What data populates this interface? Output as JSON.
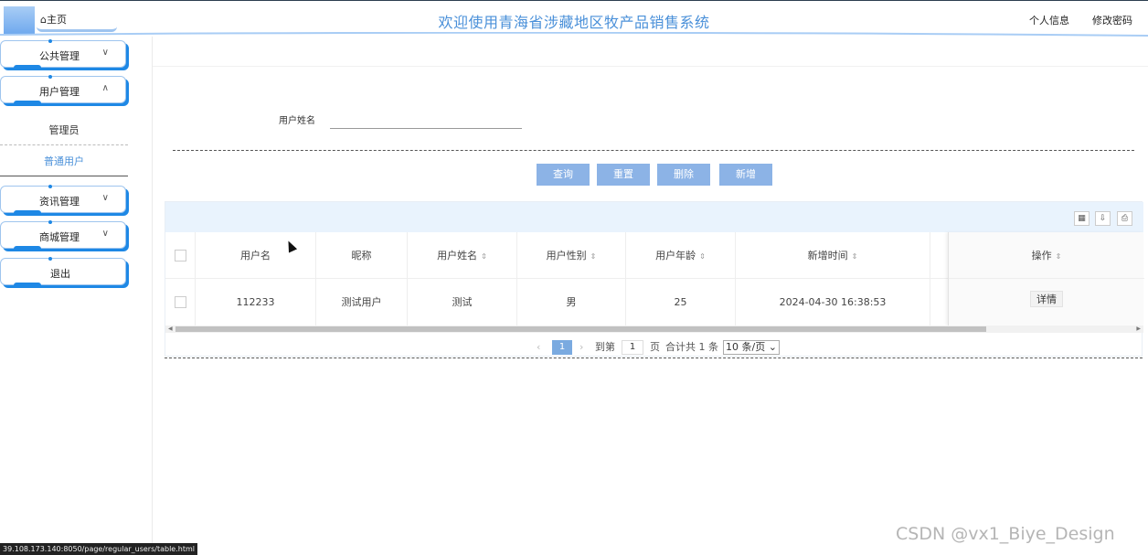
{
  "header": {
    "home_icon": "home-icon",
    "home_label": "⌂主页",
    "title": "欢迎使用青海省涉藏地区牧产品销售系统",
    "profile_link": "个人信息",
    "password_link": "修改密码"
  },
  "sidebar": {
    "menus": [
      {
        "label": "公共管理",
        "icon": "chevron-down-icon",
        "glyph": "∨"
      },
      {
        "label": "用户管理",
        "icon": "chevron-up-icon",
        "glyph": "∧"
      },
      {
        "label": "资讯管理",
        "icon": "chevron-down-icon",
        "glyph": "∨"
      },
      {
        "label": "商城管理",
        "icon": "chevron-down-icon",
        "glyph": "∨"
      },
      {
        "label": "退出"
      }
    ],
    "submenu": [
      {
        "label": "管理员"
      },
      {
        "label": "普通用户",
        "active": true
      }
    ]
  },
  "search": {
    "label": "用户姓名",
    "value": ""
  },
  "buttons": {
    "query": "查询",
    "reset": "重置",
    "delete": "删除",
    "add": "新增"
  },
  "table": {
    "columns": [
      "用户名",
      "昵称",
      "用户姓名",
      "用户性别",
      "用户年龄",
      "新增时间",
      "操作"
    ],
    "sortable": [
      false,
      false,
      true,
      true,
      true,
      true,
      true
    ],
    "rows": [
      {
        "username": "112233",
        "nickname": "测试用户",
        "name": "测试",
        "gender": "男",
        "age": "25",
        "created": "2024-04-30 16:38:53",
        "action": "详情"
      }
    ],
    "toolbar_icons": [
      "columns-icon",
      "export-icon",
      "print-icon"
    ]
  },
  "pagination": {
    "prev": "‹",
    "current": "1",
    "next": "›",
    "goto_label": "到第",
    "goto_value": "1",
    "page_unit": "页",
    "total_text": "合计共 1 条",
    "page_size": "10 条/页"
  },
  "status_url": "39.108.173.140:8050/page/regular_users/table.html",
  "watermark": "CSDN @vx1_Biye_Design",
  "colors": {
    "accent": "#1e88e5",
    "button": "#8cb3e6",
    "title": "#4a90d9",
    "toolbar_bg": "#e9f3fd"
  }
}
